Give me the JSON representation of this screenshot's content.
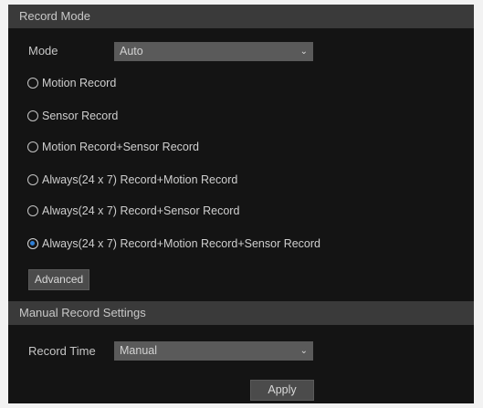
{
  "record_mode": {
    "header": "Record Mode",
    "mode_label": "Mode",
    "mode_value": "Auto",
    "options": [
      {
        "label": "Motion Record",
        "checked": false
      },
      {
        "label": "Sensor Record",
        "checked": false
      },
      {
        "label": "Motion Record+Sensor Record",
        "checked": false
      },
      {
        "label": "Always(24 x 7) Record+Motion Record",
        "checked": false
      },
      {
        "label": "Always(24 x 7) Record+Sensor Record",
        "checked": false
      },
      {
        "label": "Always(24 x 7) Record+Motion Record+Sensor Record",
        "checked": true
      }
    ],
    "advanced_label": "Advanced"
  },
  "manual_record": {
    "header": "Manual Record Settings",
    "record_time_label": "Record Time",
    "record_time_value": "Manual"
  },
  "apply_label": "Apply",
  "colors": {
    "panel_bg": "#141414",
    "header_bg": "#3a3a3a",
    "select_bg": "#5a5a5a",
    "radio_selected": "#2e80d8"
  },
  "icons": {
    "dropdown": "chevron-down-icon"
  }
}
